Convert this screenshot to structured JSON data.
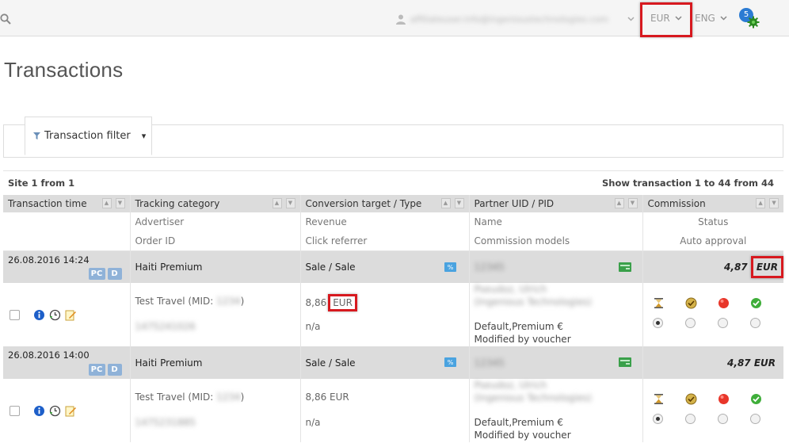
{
  "header": {
    "user_email": "affiliateuser.info@ingenioustechnologies.com",
    "currency": "EUR",
    "language": "ENG",
    "notifications": "5"
  },
  "page_title": "Transactions",
  "filter": {
    "label": "Transaction filter",
    "caret": "▾"
  },
  "pager": {
    "site": "Site 1 from 1",
    "range": "Show transaction 1 to 44 from 44"
  },
  "columns": [
    {
      "label": "Transaction time",
      "sub1": "",
      "sub2": ""
    },
    {
      "label": "Tracking category",
      "sub1": "Advertiser",
      "sub2": "Order ID"
    },
    {
      "label": "Conversion target / Type",
      "sub1": "Revenue",
      "sub2": "Click referrer"
    },
    {
      "label": "Partner UID / PID",
      "sub1": "Name",
      "sub2": "Commission models"
    },
    {
      "label": "Commission",
      "sub1": "Status",
      "sub2": "Auto approval"
    }
  ],
  "sort": {
    "asc": "▲",
    "desc": "▼"
  },
  "badges": {
    "pc": "PC",
    "d": "D"
  },
  "transactions": [
    {
      "time": "26.08.2016 14:24",
      "category": "Haiti Premium",
      "type": "Sale / Sale",
      "partner_uid": "12345",
      "commission_value": "4,87",
      "commission_currency": "EUR",
      "advertiser": "Test Travel (MID: ",
      "advertiser_mid": "1234",
      "advertiser_suffix": ")",
      "order_id": "1475241026",
      "revenue_value": "8,86",
      "revenue_currency": "EUR",
      "referrer": "n/a",
      "partner_name": "Pseudoz, Ulrich",
      "partner_company": "(Ingenious Technologies)",
      "models": "Default,Premium €",
      "modified": "Modified by voucher"
    },
    {
      "time": "26.08.2016 14:00",
      "category": "Haiti Premium",
      "type": "Sale / Sale",
      "partner_uid": "12345",
      "commission_value": "4,87 EUR",
      "commission_currency": "",
      "advertiser": "Test Travel (MID: ",
      "advertiser_mid": "1234",
      "advertiser_suffix": ")",
      "order_id": "1475231885",
      "revenue_value": "8,86 EUR",
      "revenue_currency": "",
      "referrer": "n/a",
      "partner_name": "Pseudoz, Ulrich",
      "partner_company": "(Ingenious Technologies)",
      "models": "Default,Premium €",
      "modified": "Modified by voucher"
    }
  ],
  "colors": {
    "highlight": "#d7191f",
    "header_bg": "#dcdcdc",
    "badge": "#8fb2d8"
  }
}
